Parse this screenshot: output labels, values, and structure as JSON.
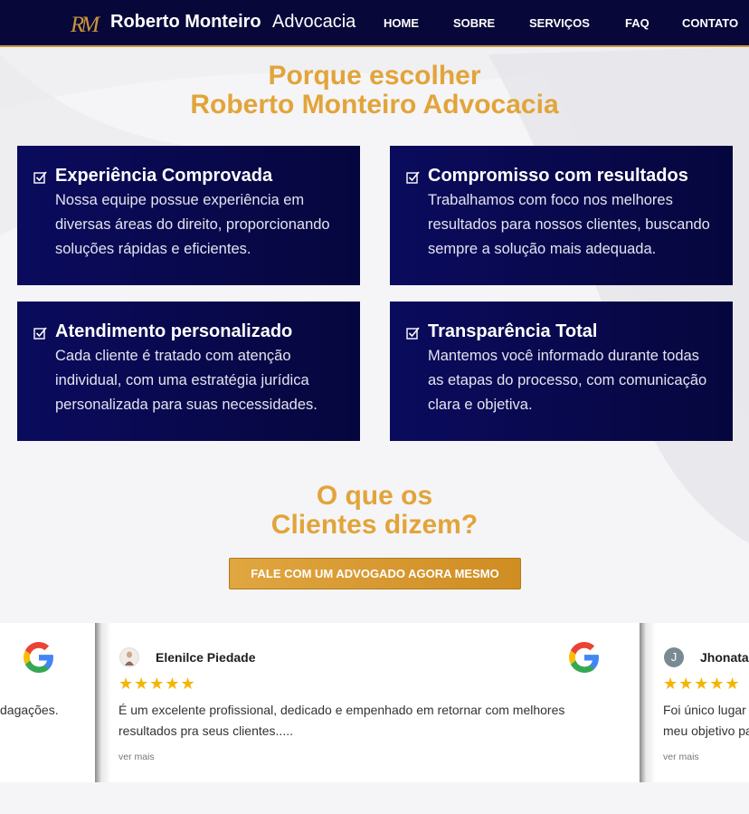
{
  "header": {
    "logo_mark": "RM",
    "brand_name": "Roberto Monteiro",
    "brand_sub": "Advocacia",
    "nav": [
      "HOME",
      "SOBRE",
      "SERVIÇOS",
      "FAQ",
      "CONTATO"
    ]
  },
  "why": {
    "title_line1": "Porque escolher",
    "title_line2": "Roberto Monteiro Advocacia",
    "cards": [
      {
        "title": "Experiência Comprovada",
        "lines": [
          "Nossa equipe possue experiência em",
          "diversas áreas do direito, proporcionando",
          "soluções rápidas e eficientes."
        ]
      },
      {
        "title": "Compromisso com resultados",
        "lines": [
          "Trabalhamos com foco nos melhores",
          "resultados para nossos clientes, buscando",
          "sempre a solução mais adequada."
        ]
      },
      {
        "title": "Atendimento personalizado",
        "lines": [
          "Cada cliente é tratado com atenção",
          "individual, com uma estratégia jurídica",
          "personalizada para suas necessidades."
        ]
      },
      {
        "title": "Transparência Total",
        "lines": [
          "Mantemos você informado durante todas",
          "as etapas do processo, com comunicação",
          "clara e objetiva."
        ]
      }
    ]
  },
  "testimonials": {
    "title_line1": "O que os",
    "title_line2": "Clientes dizem?",
    "cta_label": "FALE COM UM ADVOGADO AGORA MESMO",
    "stars": "★★★★★",
    "google_letter": "G",
    "reviews": [
      {
        "name": "",
        "text_lines": [
          "dagações."
        ],
        "read_more": ""
      },
      {
        "name": "Elenilce Piedade",
        "text_lines": [
          "É um excelente profissional, dedicado e empenhado em retornar com melhores",
          "resultados pra seus clientes....."
        ],
        "read_more": "ver mais"
      },
      {
        "name": "Jhonata",
        "avatar_letter": "J",
        "text_lines": [
          "Foi único lugar",
          "meu objetivo pa"
        ],
        "read_more": "ver mais"
      }
    ]
  },
  "colors": {
    "navy": "#07073a",
    "gold": "#e2a43a",
    "star": "#f5b400"
  }
}
